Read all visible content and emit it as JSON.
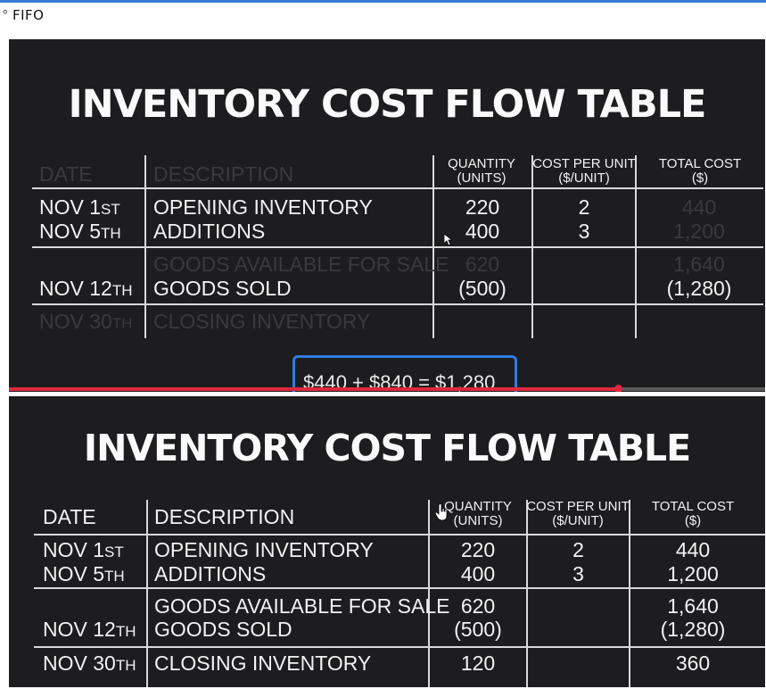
{
  "page": {
    "label": "FIFO"
  },
  "frames": [
    {
      "title": "INVENTORY COST FLOW TABLE",
      "headers": {
        "date": "DATE",
        "description": "DESCRIPTION",
        "quantity_1": "QUANTITY",
        "quantity_2": "(UNITS)",
        "cost_1": "COST PER UNIT",
        "cost_2": "($/UNIT)",
        "total_1": "TOTAL COST",
        "total_2": "($)"
      },
      "rows": [
        {
          "date": "NOV 1",
          "date_suffix": "ST",
          "description": "OPENING INVENTORY",
          "quantity": "220",
          "cost": "2",
          "total": "440"
        },
        {
          "date": "NOV 5",
          "date_suffix": "TH",
          "description": "ADDITIONS",
          "quantity": "400",
          "cost": "3",
          "total": "1,200"
        },
        {
          "date": "",
          "date_suffix": "",
          "description": "GOODS AVAILABLE FOR SALE",
          "quantity": "620",
          "cost": "",
          "total": "1,640"
        },
        {
          "date": "NOV 12",
          "date_suffix": "TH",
          "description": "GOODS SOLD",
          "quantity": "(500)",
          "cost": "",
          "total": "(1,280)"
        },
        {
          "date": "NOV 30",
          "date_suffix": "TH",
          "description": "CLOSING INVENTORY",
          "quantity": "",
          "cost": "",
          "total": ""
        }
      ],
      "formula": "$440 + $840 = $1,280",
      "video_progress": 0.805,
      "colors": {
        "progress": "#e0283c",
        "annotation_box": "#2f7de1"
      }
    },
    {
      "title": "INVENTORY COST FLOW TABLE",
      "headers": {
        "date": "DATE",
        "description": "DESCRIPTION",
        "quantity_1": "QUANTITY",
        "quantity_2": "(UNITS)",
        "cost_1": "COST PER UNIT",
        "cost_2": "($/UNIT)",
        "total_1": "TOTAL COST",
        "total_2": "($)"
      },
      "rows": [
        {
          "date": "NOV 1",
          "date_suffix": "ST",
          "description": "OPENING INVENTORY",
          "quantity": "220",
          "cost": "2",
          "total": "440"
        },
        {
          "date": "NOV 5",
          "date_suffix": "TH",
          "description": "ADDITIONS",
          "quantity": "400",
          "cost": "3",
          "total": "1,200"
        },
        {
          "date": "",
          "date_suffix": "",
          "description": "GOODS AVAILABLE FOR SALE",
          "quantity": "620",
          "cost": "",
          "total": "1,640"
        },
        {
          "date": "NOV 12",
          "date_suffix": "TH",
          "description": "GOODS SOLD",
          "quantity": "(500)",
          "cost": "",
          "total": "(1,280)"
        },
        {
          "date": "NOV 30",
          "date_suffix": "TH",
          "description": "CLOSING INVENTORY",
          "quantity": "120",
          "cost": "",
          "total": "360"
        }
      ]
    }
  ]
}
